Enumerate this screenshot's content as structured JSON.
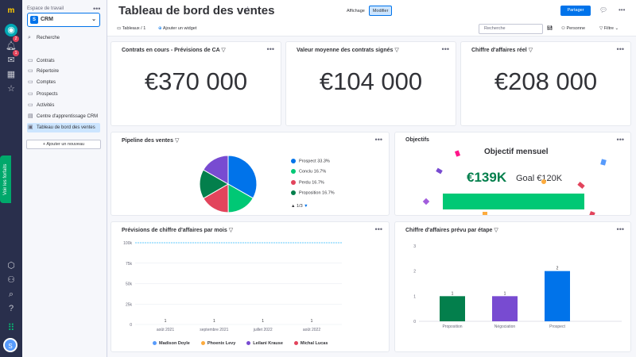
{
  "rail": {
    "badges": [
      "2",
      "1"
    ],
    "vertical_tab": "Voir les forfaits",
    "avatar": "S"
  },
  "sidebar": {
    "workspace_label": "Espace de travail",
    "workspace_name": "CRM",
    "workspace_letter": "S",
    "search": "Recherche",
    "items": [
      "Contrats",
      "Répertoire",
      "Comptes",
      "Prospects",
      "Activités",
      "Centre d'apprentissage CRM",
      "Tableau de bord des ventes"
    ],
    "add_new": "+ Ajouter un nouveau"
  },
  "header": {
    "title": "Tableau de bord des ventes",
    "view_label": "Affichage",
    "edit_label": "Modifier",
    "share_label": "Partager",
    "boards": "Tableaux / 1",
    "add_widget": "Ajouter un widget",
    "search_placeholder": "Recherche",
    "person": "Personne",
    "filter": "Filtre"
  },
  "widgets": {
    "w1": {
      "title": "Contrats en cours - Prévisions de CA",
      "value": "€370 000"
    },
    "w2": {
      "title": "Valeur moyenne des contrats signés",
      "value": "€104 000"
    },
    "w3": {
      "title": "Chiffre d'affaires réel",
      "value": "€208 000"
    },
    "pipeline": {
      "title": "Pipeline des ventes",
      "pager": "1/3"
    },
    "goals": {
      "title": "Objectifs",
      "heading": "Objectif mensuel",
      "amount": "€139K",
      "goal": "Goal €120K"
    },
    "forecast": {
      "title": "Prévisions de chiffre d'affaires par mois"
    },
    "stage": {
      "title": "Chiffre d'affaires prévu par étape"
    }
  },
  "colors": {
    "blue": "#0073ea",
    "green": "#037f4c",
    "lightgreen": "#00c875",
    "purple": "#784bd1",
    "red": "#e2445c",
    "orange": "#fdab3d"
  },
  "chart_data": [
    {
      "type": "pie",
      "title": "Pipeline des ventes",
      "categories": [
        "Prospect",
        "Conclu",
        "Perdu",
        "Proposition"
      ],
      "values": [
        33.3,
        16.7,
        16.7,
        16.7
      ],
      "labels": [
        "Prospect 33.3%",
        "Conclu 16.7%",
        "Perdu 16.7%",
        "Proposition 16.7%"
      ],
      "colors": [
        "#0073ea",
        "#00c875",
        "#e2445c",
        "#037f4c"
      ],
      "extra_slice_color": "#784bd1",
      "extra_slice_value": 16.7
    },
    {
      "type": "bar",
      "title": "Prévisions de chiffre d'affaires par mois",
      "categories": [
        "août 2021",
        "septembre 2021",
        "juillet 2022",
        "août 2022"
      ],
      "yticks": [
        "100k",
        "75k",
        "50k",
        "25k",
        "0"
      ],
      "ylim": [
        0,
        100000
      ],
      "point_labels": [
        "1",
        "1",
        "1",
        "1"
      ],
      "goal_line": 100000,
      "series": [
        {
          "name": "Madison Doyle",
          "color": "#579bfc"
        },
        {
          "name": "Phoenix Levy",
          "color": "#fdab3d"
        },
        {
          "name": "Leilani Krause",
          "color": "#784bd1"
        },
        {
          "name": "Michal Lucas",
          "color": "#e2445c"
        }
      ]
    },
    {
      "type": "bar",
      "title": "Chiffre d'affaires prévu par étape",
      "categories": [
        "Proposition",
        "Négociation",
        "Prospect"
      ],
      "values": [
        1,
        1,
        2
      ],
      "value_labels": [
        "1",
        "1",
        "2"
      ],
      "yticks": [
        "3",
        "2",
        "1",
        "0"
      ],
      "ylim": [
        0,
        3
      ],
      "colors": [
        "#037f4c",
        "#784bd1",
        "#0073ea"
      ]
    }
  ]
}
